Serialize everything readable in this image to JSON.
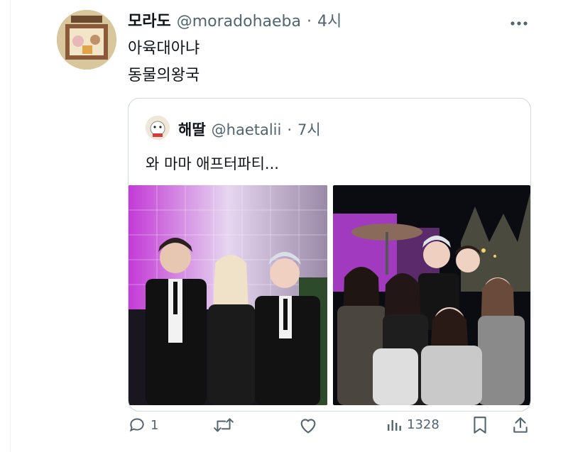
{
  "tweet": {
    "display_name": "모라도",
    "handle": "@moradohaeba",
    "separator": "·",
    "time": "4시",
    "lines": [
      "아육대아냐",
      "동물의왕국"
    ]
  },
  "quoted": {
    "display_name": "해딸",
    "handle": "@haetalii",
    "separator": "·",
    "time": "7시",
    "text": "와 마마 애프터파티..."
  },
  "actions": {
    "reply_count": "1",
    "retweet_count": "",
    "like_count": "",
    "views_count": "1328"
  },
  "icons": {
    "more": "more-icon",
    "reply": "reply-icon",
    "retweet": "retweet-icon",
    "like": "heart-icon",
    "views": "views-icon",
    "bookmark": "bookmark-icon",
    "share": "share-icon"
  },
  "colors": {
    "text": "#0f1419",
    "secondary": "#536471",
    "border": "#cfd9de"
  }
}
